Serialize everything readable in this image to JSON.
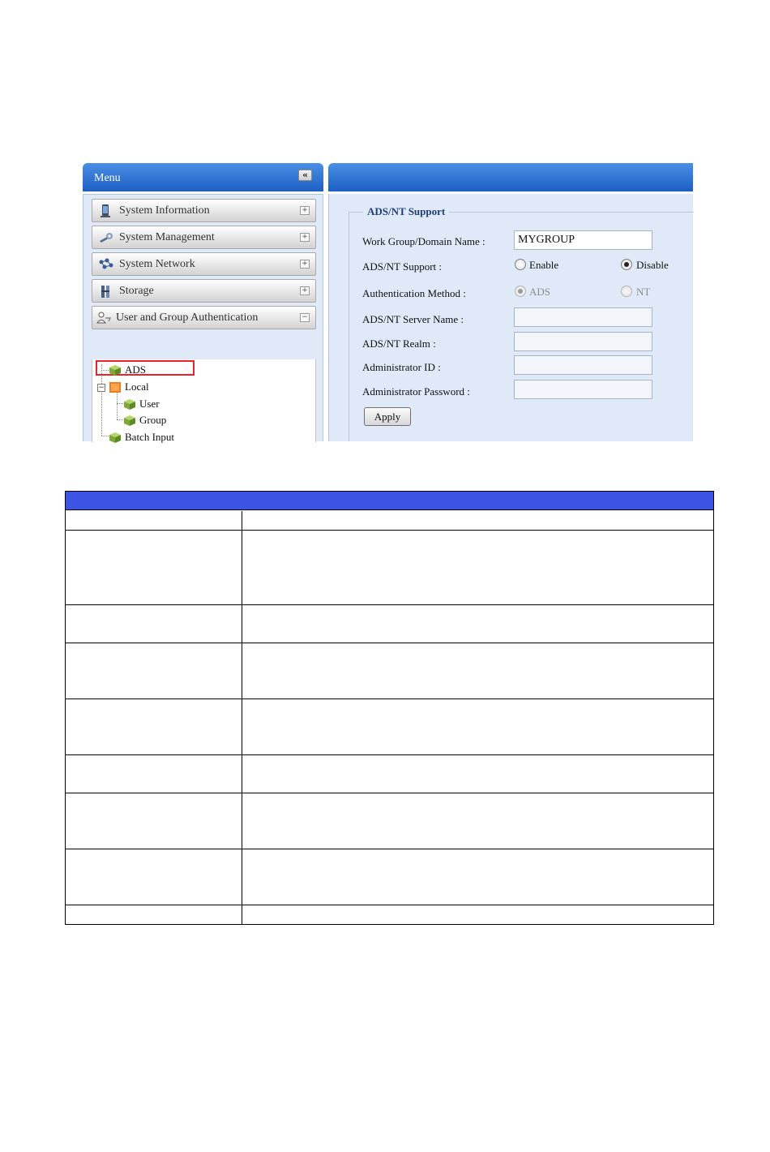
{
  "menu": {
    "title": "Menu",
    "collapse_glyph": "«",
    "items": [
      {
        "label": "System Information",
        "icon": "monitor-icon",
        "toggle": "+"
      },
      {
        "label": "System Management",
        "icon": "wrench-icon",
        "toggle": "+"
      },
      {
        "label": "System Network",
        "icon": "network-icon",
        "toggle": "+"
      },
      {
        "label": "Storage",
        "icon": "storage-icon",
        "toggle": "+"
      },
      {
        "label": "User and Group Authentication",
        "icon": "users-icon",
        "toggle": "−"
      }
    ],
    "tree": {
      "expander": "−",
      "ads": "ADS",
      "local": "Local",
      "user": "User",
      "group": "Group",
      "batch_input": "Batch Input"
    }
  },
  "form": {
    "legend": "ADS/NT Support",
    "workgroup_label": "Work Group/Domain Name :",
    "workgroup_value": "MYGROUP",
    "support_label": "ADS/NT Support :",
    "support_options": {
      "enable": "Enable",
      "disable": "Disable",
      "selected": "Disable"
    },
    "auth_label": "Authentication Method :",
    "auth_options": {
      "ads": "ADS",
      "nt": "NT",
      "selected": "ADS",
      "disabled": true
    },
    "server_name_label": "ADS/NT Server Name :",
    "server_name_value": "",
    "realm_label": "ADS/NT Realm :",
    "realm_value": "",
    "admin_id_label": "Administrator ID :",
    "admin_id_value": "",
    "admin_password_label": "Administrator Password :",
    "admin_password_value": "",
    "apply_label": "Apply"
  },
  "colors": {
    "header_blue": "#1d5fc2",
    "panel_bg": "#dfe9f7",
    "table_header": "#3b54e3",
    "highlight_red": "#e8232a"
  }
}
